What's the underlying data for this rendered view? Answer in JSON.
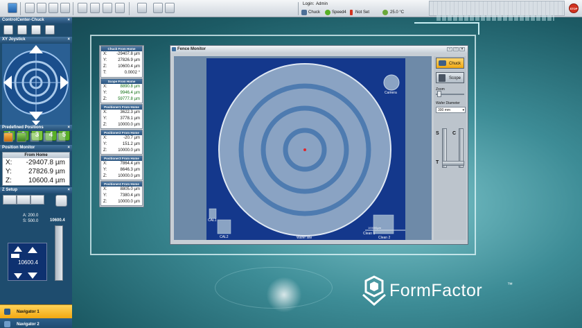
{
  "toolbar": {
    "login_label": "Login:",
    "login_user": "Admin",
    "chuck_status": "Chuck",
    "speed_status": "Speed4",
    "set_status": "Not Set",
    "temperature": "25.0 °C",
    "stop_label": "STOP"
  },
  "control_center": {
    "title": "ControlCenter-Chuck",
    "close": "×"
  },
  "joystick": {
    "title": "XY Joystick",
    "close": "×",
    "speed_buttons": [
      "1",
      "2",
      "3",
      "4",
      "5"
    ]
  },
  "predefined": {
    "title": "Predefined Positions",
    "close": "×"
  },
  "position_monitor": {
    "title": "Position Monitor",
    "close": "×",
    "header": "From Home",
    "rows": [
      {
        "label": "X:",
        "value": "-29407.8 µm"
      },
      {
        "label": "Y:",
        "value": "27826.9 µm"
      },
      {
        "label": "Z:",
        "value": "10600.4 µm"
      }
    ]
  },
  "z_setup": {
    "title": "Z Setup",
    "close": "×",
    "a_value": "A: 200.0",
    "s_value": "S: 500.0",
    "z_current": "10600.4",
    "pad_value": "10600.4"
  },
  "navigators": [
    {
      "label": "Navigator 1",
      "active": true
    },
    {
      "label": "Navigator 2",
      "active": false
    }
  ],
  "coords": {
    "groups": [
      {
        "title": "Chuck From Home",
        "rows": [
          {
            "label": "X:",
            "value": "-29407.8 µm"
          },
          {
            "label": "Y:",
            "value": "27826.9 µm"
          },
          {
            "label": "Z:",
            "value": "10600.4 µm"
          },
          {
            "label": "T:",
            "value": "0.0002 °"
          }
        ]
      },
      {
        "title": "Scope From Home",
        "rows": [
          {
            "label": "X:",
            "value": "8890.8 µm"
          },
          {
            "label": "Y:",
            "value": "9946.4 µm"
          },
          {
            "label": "Z:",
            "value": "59777.8 µm"
          }
        ]
      },
      {
        "title": "Positioner1 From Home",
        "rows": [
          {
            "label": "X:",
            "value": "3622.3 µm"
          },
          {
            "label": "Y:",
            "value": "3778.1 µm"
          },
          {
            "label": "Z:",
            "value": "10000.0 µm"
          }
        ]
      },
      {
        "title": "Positioner2 From Home",
        "rows": [
          {
            "label": "X:",
            "value": "-20.7 µm"
          },
          {
            "label": "Y:",
            "value": "151.2 µm"
          },
          {
            "label": "Z:",
            "value": "10000.0 µm"
          }
        ]
      },
      {
        "title": "Positioner3 From Home",
        "rows": [
          {
            "label": "X:",
            "value": "7864.4 µm"
          },
          {
            "label": "Y:",
            "value": "8646.3 µm"
          },
          {
            "label": "Z:",
            "value": "10000.0 µm"
          }
        ]
      },
      {
        "title": "Positioner4 From Home",
        "rows": [
          {
            "label": "X:",
            "value": "8805.0 µm"
          },
          {
            "label": "Y:",
            "value": "7380.4 µm"
          },
          {
            "label": "Z:",
            "value": "10000.0 µm"
          }
        ]
      }
    ]
  },
  "fence": {
    "title": "Fence Monitor",
    "camera_label": "Camera",
    "cal1": "CAL1",
    "cal2": "CAL2",
    "wafer_site": "Wafer site",
    "clean1": "Clean 1",
    "clean2": "Clean 2",
    "scale_label": "100000µm",
    "chuck_button": "Chuck",
    "scope_button": "Scope",
    "zoom_label": "Zoom",
    "wafer_diameter_label": "Wafer Diameter",
    "wafer_diameter_value": "300 mm",
    "s_label": "S",
    "c_label": "C",
    "t_label": "T"
  },
  "brand": {
    "name": "FormFactor",
    "tm": "™"
  },
  "colors": {
    "wafer_field": "#14388c",
    "wafer": "#8aa3c3",
    "ring": "#4e7bb0",
    "accent_orange": "#f2a810",
    "go_green": "#58b026"
  }
}
